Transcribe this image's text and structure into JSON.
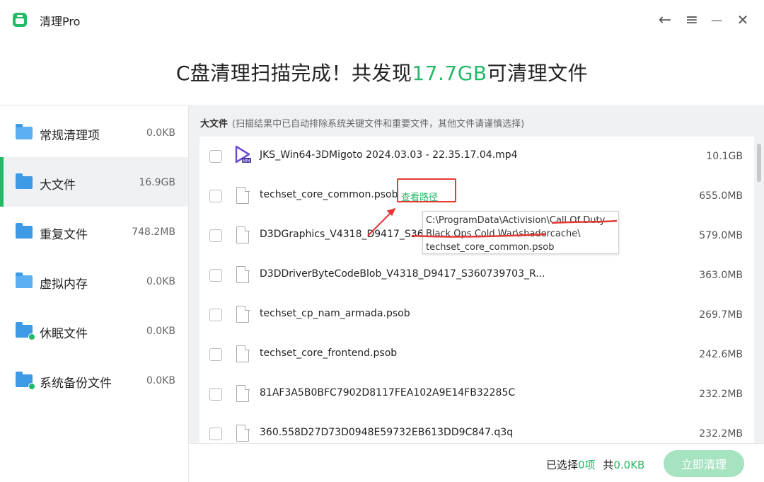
{
  "app": {
    "title": "清理Pro"
  },
  "titlebar": {
    "back": "←",
    "menu": "≡",
    "minimize": "—",
    "close": "✕"
  },
  "headline": {
    "prefix": "C盘清理扫描完成！共发现",
    "amount": "17.7GB",
    "suffix": "可清理文件"
  },
  "sidebar": {
    "items": [
      {
        "label": "常规清理项",
        "size": "0.0KB",
        "icon": "broom-folder-icon"
      },
      {
        "label": "大文件",
        "size": "16.9GB",
        "icon": "folder-icon",
        "active": true
      },
      {
        "label": "重复文件",
        "size": "748.2MB",
        "icon": "folders-icon"
      },
      {
        "label": "虚拟内存",
        "size": "0.0KB",
        "icon": "memory-folder-icon"
      },
      {
        "label": "休眠文件",
        "size": "0.0KB",
        "icon": "sleep-folder-icon"
      },
      {
        "label": "系统备份文件",
        "size": "0.0KB",
        "icon": "backup-folder-icon"
      }
    ]
  },
  "section": {
    "title": "大文件",
    "note": "(扫描结果中已自动排除系统关键文件和重要文件，其他文件请谨慎选择)"
  },
  "files": [
    {
      "name": "JKS_Win64-3DMigoto 2024.03.03 - 22.35.17.04.mp4",
      "size": "10.1GB",
      "icon": "video-play-icon"
    },
    {
      "name": "techset_core_common.psob",
      "size": "655.0MB",
      "icon": "file-icon",
      "link": "查看路径"
    },
    {
      "name": "D3DGraphics_V4318_D9417_S360",
      "size": "579.0MB",
      "icon": "file-icon"
    },
    {
      "name": "D3DDriverByteCodeBlob_V4318_D9417_S360739703_R...",
      "size": "363.0MB",
      "icon": "file-icon"
    },
    {
      "name": "techset_cp_nam_armada.psob",
      "size": "269.7MB",
      "icon": "file-icon"
    },
    {
      "name": "techset_core_frontend.psob",
      "size": "242.6MB",
      "icon": "file-icon"
    },
    {
      "name": "81AF3A5B0BFC7902D8117FEA102A9E14FB32285C",
      "size": "232.2MB",
      "icon": "file-icon"
    },
    {
      "name": "360.558D27D73D0948E59732EB613DD9C847.q3q",
      "size": "232.2MB",
      "icon": "file-icon"
    }
  ],
  "tooltip": {
    "line1": "C:\\ProgramData\\Activision\\Call Of Duty",
    "line2": "Black Ops Cold War\\shadercache\\",
    "line3": "techset_core_common.psob"
  },
  "footer": {
    "selected_prefix": "已选择",
    "selected_count": "0项",
    "total_prefix": "共",
    "total_size": "0.0KB",
    "button": "立即清理"
  },
  "colors": {
    "accent": "#23b967",
    "annotation": "#e53935",
    "sidebar_active_bg": "#f0f1f3"
  }
}
